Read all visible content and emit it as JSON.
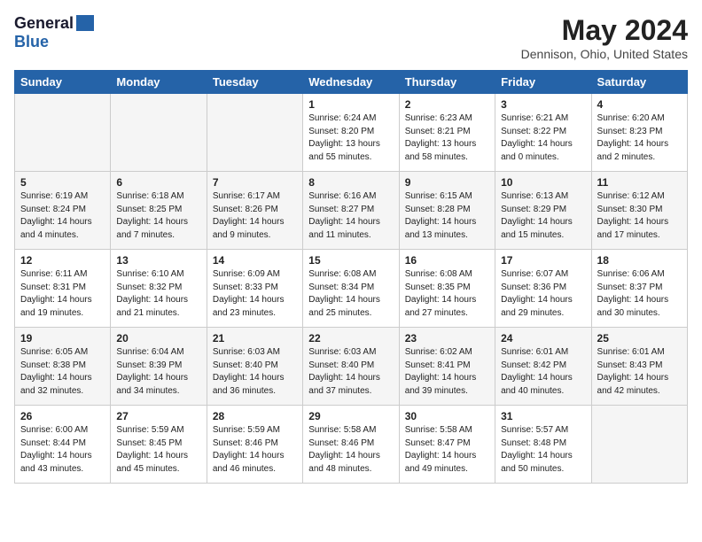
{
  "header": {
    "logo_general": "General",
    "logo_blue": "Blue",
    "month_title": "May 2024",
    "location": "Dennison, Ohio, United States"
  },
  "days_of_week": [
    "Sunday",
    "Monday",
    "Tuesday",
    "Wednesday",
    "Thursday",
    "Friday",
    "Saturday"
  ],
  "weeks": [
    [
      {
        "day": "",
        "empty": true
      },
      {
        "day": "",
        "empty": true
      },
      {
        "day": "",
        "empty": true
      },
      {
        "day": "1",
        "sunrise": "6:24 AM",
        "sunset": "8:20 PM",
        "daylight": "13 hours and 55 minutes."
      },
      {
        "day": "2",
        "sunrise": "6:23 AM",
        "sunset": "8:21 PM",
        "daylight": "13 hours and 58 minutes."
      },
      {
        "day": "3",
        "sunrise": "6:21 AM",
        "sunset": "8:22 PM",
        "daylight": "14 hours and 0 minutes."
      },
      {
        "day": "4",
        "sunrise": "6:20 AM",
        "sunset": "8:23 PM",
        "daylight": "14 hours and 2 minutes."
      }
    ],
    [
      {
        "day": "5",
        "sunrise": "6:19 AM",
        "sunset": "8:24 PM",
        "daylight": "14 hours and 4 minutes."
      },
      {
        "day": "6",
        "sunrise": "6:18 AM",
        "sunset": "8:25 PM",
        "daylight": "14 hours and 7 minutes."
      },
      {
        "day": "7",
        "sunrise": "6:17 AM",
        "sunset": "8:26 PM",
        "daylight": "14 hours and 9 minutes."
      },
      {
        "day": "8",
        "sunrise": "6:16 AM",
        "sunset": "8:27 PM",
        "daylight": "14 hours and 11 minutes."
      },
      {
        "day": "9",
        "sunrise": "6:15 AM",
        "sunset": "8:28 PM",
        "daylight": "14 hours and 13 minutes."
      },
      {
        "day": "10",
        "sunrise": "6:13 AM",
        "sunset": "8:29 PM",
        "daylight": "14 hours and 15 minutes."
      },
      {
        "day": "11",
        "sunrise": "6:12 AM",
        "sunset": "8:30 PM",
        "daylight": "14 hours and 17 minutes."
      }
    ],
    [
      {
        "day": "12",
        "sunrise": "6:11 AM",
        "sunset": "8:31 PM",
        "daylight": "14 hours and 19 minutes."
      },
      {
        "day": "13",
        "sunrise": "6:10 AM",
        "sunset": "8:32 PM",
        "daylight": "14 hours and 21 minutes."
      },
      {
        "day": "14",
        "sunrise": "6:09 AM",
        "sunset": "8:33 PM",
        "daylight": "14 hours and 23 minutes."
      },
      {
        "day": "15",
        "sunrise": "6:08 AM",
        "sunset": "8:34 PM",
        "daylight": "14 hours and 25 minutes."
      },
      {
        "day": "16",
        "sunrise": "6:08 AM",
        "sunset": "8:35 PM",
        "daylight": "14 hours and 27 minutes."
      },
      {
        "day": "17",
        "sunrise": "6:07 AM",
        "sunset": "8:36 PM",
        "daylight": "14 hours and 29 minutes."
      },
      {
        "day": "18",
        "sunrise": "6:06 AM",
        "sunset": "8:37 PM",
        "daylight": "14 hours and 30 minutes."
      }
    ],
    [
      {
        "day": "19",
        "sunrise": "6:05 AM",
        "sunset": "8:38 PM",
        "daylight": "14 hours and 32 minutes."
      },
      {
        "day": "20",
        "sunrise": "6:04 AM",
        "sunset": "8:39 PM",
        "daylight": "14 hours and 34 minutes."
      },
      {
        "day": "21",
        "sunrise": "6:03 AM",
        "sunset": "8:40 PM",
        "daylight": "14 hours and 36 minutes."
      },
      {
        "day": "22",
        "sunrise": "6:03 AM",
        "sunset": "8:40 PM",
        "daylight": "14 hours and 37 minutes."
      },
      {
        "day": "23",
        "sunrise": "6:02 AM",
        "sunset": "8:41 PM",
        "daylight": "14 hours and 39 minutes."
      },
      {
        "day": "24",
        "sunrise": "6:01 AM",
        "sunset": "8:42 PM",
        "daylight": "14 hours and 40 minutes."
      },
      {
        "day": "25",
        "sunrise": "6:01 AM",
        "sunset": "8:43 PM",
        "daylight": "14 hours and 42 minutes."
      }
    ],
    [
      {
        "day": "26",
        "sunrise": "6:00 AM",
        "sunset": "8:44 PM",
        "daylight": "14 hours and 43 minutes."
      },
      {
        "day": "27",
        "sunrise": "5:59 AM",
        "sunset": "8:45 PM",
        "daylight": "14 hours and 45 minutes."
      },
      {
        "day": "28",
        "sunrise": "5:59 AM",
        "sunset": "8:46 PM",
        "daylight": "14 hours and 46 minutes."
      },
      {
        "day": "29",
        "sunrise": "5:58 AM",
        "sunset": "8:46 PM",
        "daylight": "14 hours and 48 minutes."
      },
      {
        "day": "30",
        "sunrise": "5:58 AM",
        "sunset": "8:47 PM",
        "daylight": "14 hours and 49 minutes."
      },
      {
        "day": "31",
        "sunrise": "5:57 AM",
        "sunset": "8:48 PM",
        "daylight": "14 hours and 50 minutes."
      },
      {
        "day": "",
        "empty": true
      }
    ]
  ],
  "labels": {
    "sunrise": "Sunrise:",
    "sunset": "Sunset:",
    "daylight": "Daylight hours"
  }
}
